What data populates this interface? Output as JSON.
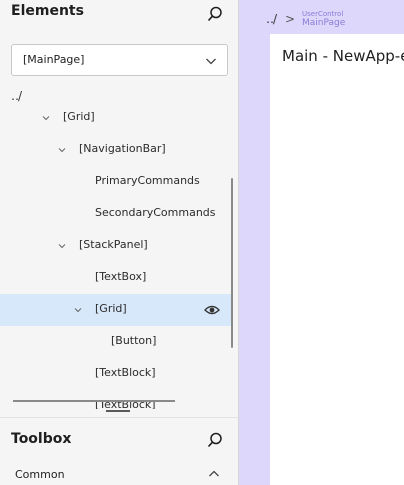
{
  "elements_panel": {
    "title": "Elements",
    "selector_value": "[MainPage]",
    "up_level": "‥/"
  },
  "tree": [
    {
      "label": "[Grid]",
      "expanded": true
    },
    {
      "label": "[NavigationBar]",
      "expanded": true
    },
    {
      "label": "PrimaryCommands"
    },
    {
      "label": "SecondaryCommands"
    },
    {
      "label": "[StackPanel]",
      "expanded": true
    },
    {
      "label": "[TextBox]"
    },
    {
      "label": "[Grid]",
      "expanded": true,
      "selected": true
    },
    {
      "label": "[Button]"
    },
    {
      "label": "[TextBlock]"
    },
    {
      "label": "[TextBlock]"
    }
  ],
  "toolbox": {
    "title": "Toolbox",
    "category": "Common"
  },
  "breadcrumb": {
    "up_level": "‥/",
    "separator": ">",
    "type": "UserControl",
    "name": "MainPage"
  },
  "canvas": {
    "page_title": "Main - NewApp-e"
  },
  "colors": {
    "panel_bg": "#f5f5f5",
    "selected_row": "#d7e8fa",
    "canvas_bg": "#ddd8fb",
    "breadcrumb_accent": "#8a7bd8"
  }
}
